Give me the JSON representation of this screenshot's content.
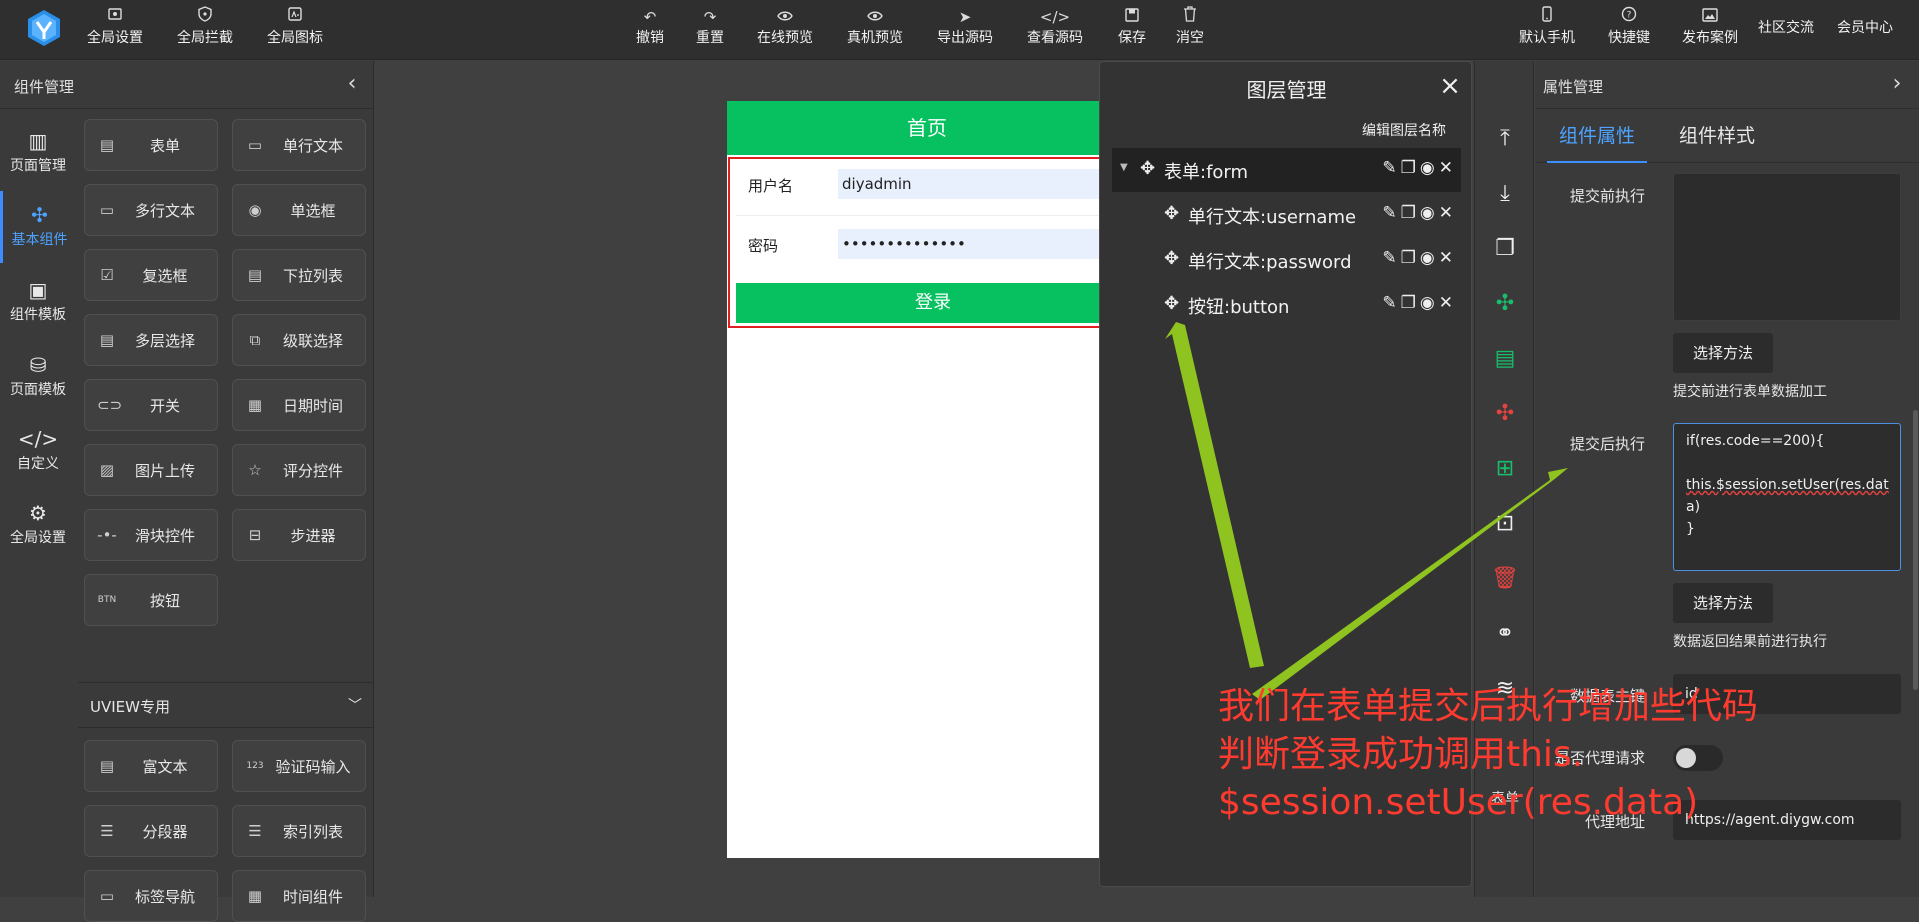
{
  "colors": {
    "accent": "#3c8dff",
    "brand_green": "#07c160",
    "annotation_red": "#ff3b30",
    "arrow_green": "#8fc31f"
  },
  "toolbar": {
    "left": [
      {
        "label": "全局设置",
        "icon": "settings-icon"
      },
      {
        "label": "全局拦截",
        "icon": "shield-icon"
      },
      {
        "label": "全局图标",
        "icon": "icon-library-icon"
      }
    ],
    "center": [
      {
        "label": "撤销",
        "icon": "undo-icon"
      },
      {
        "label": "重置",
        "icon": "redo-icon"
      },
      {
        "label": "在线预览",
        "icon": "eye-icon"
      },
      {
        "label": "真机预览",
        "icon": "eye-icon"
      },
      {
        "label": "导出源码",
        "icon": "send-icon"
      },
      {
        "label": "查看源码",
        "icon": "code-icon"
      },
      {
        "label": "保存",
        "icon": "save-icon"
      },
      {
        "label": "消空",
        "icon": "trash-icon"
      }
    ],
    "right": [
      {
        "label": "默认手机",
        "icon": "phone-icon"
      },
      {
        "label": "快捷键",
        "icon": "help-icon"
      },
      {
        "label": "发布案例",
        "icon": "image-icon"
      },
      {
        "label": "社区交流"
      },
      {
        "label": "会员中心"
      }
    ]
  },
  "left_panel": {
    "title": "组件管理",
    "nav": [
      {
        "label": "页面管理",
        "icon": "layout-icon"
      },
      {
        "label": "基本组件",
        "icon": "puzzle-icon"
      },
      {
        "label": "组件模板",
        "icon": "template-icon"
      },
      {
        "label": "页面模板",
        "icon": "database-icon"
      },
      {
        "label": "自定义",
        "icon": "code-icon"
      },
      {
        "label": "全局设置",
        "icon": "gear-icon"
      }
    ],
    "components": [
      {
        "label": "表单",
        "icon": "form-icon"
      },
      {
        "label": "单行文本",
        "icon": "input-icon"
      },
      {
        "label": "多行文本",
        "icon": "textarea-icon"
      },
      {
        "label": "单选框",
        "icon": "radio-icon"
      },
      {
        "label": "复选框",
        "icon": "checkbox-icon"
      },
      {
        "label": "下拉列表",
        "icon": "select-icon"
      },
      {
        "label": "多层选择",
        "icon": "select-icon"
      },
      {
        "label": "级联选择",
        "icon": "cascade-icon"
      },
      {
        "label": "开关",
        "icon": "switch-icon"
      },
      {
        "label": "日期时间",
        "icon": "calendar-icon"
      },
      {
        "label": "图片上传",
        "icon": "image-icon"
      },
      {
        "label": "评分控件",
        "icon": "star-icon"
      },
      {
        "label": "滑块控件",
        "icon": "slider-icon"
      },
      {
        "label": "步进器",
        "icon": "stepper-icon"
      },
      {
        "label": "按钮",
        "icon": "button-icon"
      }
    ],
    "uview_title": "UVIEW专用",
    "uview_components": [
      {
        "label": "富文本",
        "icon": "richtext-icon"
      },
      {
        "label": "验证码输入",
        "icon": "code-input-icon"
      },
      {
        "label": "分段器",
        "icon": "list-icon"
      },
      {
        "label": "索引列表",
        "icon": "list-icon"
      },
      {
        "label": "标签导航",
        "icon": "tabs-icon"
      },
      {
        "label": "时间组件",
        "icon": "calendar-icon"
      }
    ]
  },
  "phone": {
    "title": "首页",
    "username_label": "用户名",
    "username_value": "diyadmin",
    "password_label": "密码",
    "password_value": "••••••••••••••",
    "login_label": "登录"
  },
  "layer_panel": {
    "title": "图层管理",
    "edit_label": "编辑图层名称",
    "rows": [
      {
        "name": "表单:form",
        "selected": true
      },
      {
        "name": "单行文本:username"
      },
      {
        "name": "单行文本:password"
      },
      {
        "name": "按钮:button"
      }
    ]
  },
  "tools": {
    "icons": [
      "move-top-icon",
      "move-bottom-icon",
      "copy-icon",
      "puzzle-icon",
      "document-icon",
      "puzzle-icon",
      "add-document-icon",
      "login-icon",
      "trash-icon",
      "link-icon",
      "layers-icon"
    ],
    "label": "表单"
  },
  "prop_panel": {
    "title": "属性管理",
    "tab_props": "组件属性",
    "tab_styles": "组件样式",
    "before_submit_label": "提交前执行",
    "before_submit_value": "",
    "select_method": "选择方法",
    "before_submit_hint": "提交前进行表单数据加工",
    "after_submit_label": "提交后执行",
    "after_submit_lines": [
      "if(res.code==200){",
      "",
      "this.$session.setUser(res.dat",
      "a)",
      "}"
    ],
    "after_submit_hint": "数据返回结果前进行执行",
    "pk_label": "数据表主键",
    "pk_value": "id",
    "proxy_label": "是否代理请求",
    "proxy_on": false,
    "proxy_url_label": "代理地址",
    "proxy_url_value": "https://agent.diygw.com"
  },
  "annotation": {
    "lines": [
      "我们在表单提交后执行增加些代码",
      "判断登录成功调用this.",
      "$session.setUser(res.data)"
    ]
  }
}
